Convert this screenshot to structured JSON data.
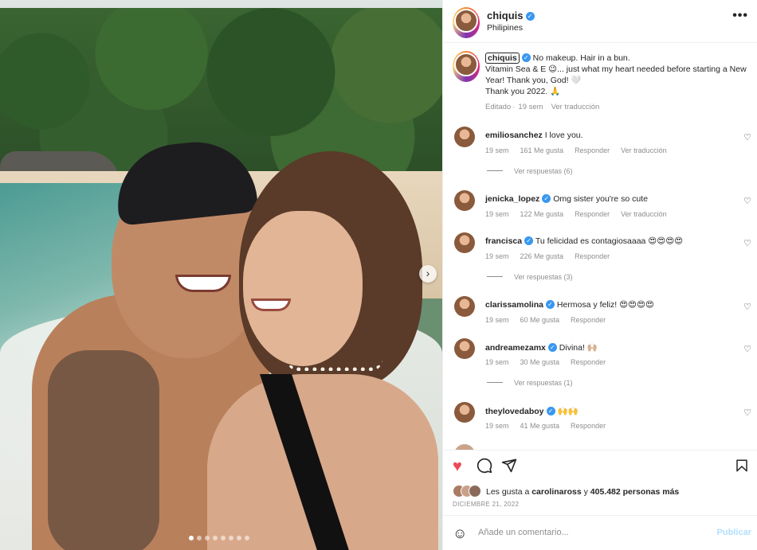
{
  "post": {
    "username": "chiquis",
    "location": "Philipines",
    "more_icon": "more-horizontal-icon",
    "photo_alt_icon": "chevron-right-icon",
    "carousel_dots": 8,
    "carousel_active_index": 0
  },
  "caption": {
    "username": "chiquis",
    "line1": " No makeup. Hair in a bun.",
    "line2": "Vitamin Sea & E 😉... just what my heart needed before starting a New Year! Thank you, God! 🤍",
    "line3": "Thank you 2022. 🙏",
    "edited": "Editado",
    "age": "19 sem",
    "translate": "Ver traducción"
  },
  "comments": [
    {
      "user": "emiliosanchez",
      "verified": false,
      "text": "I love you.",
      "age": "19 sem",
      "likes": "161 Me gusta",
      "reply": "Responder",
      "translate": "Ver traducción",
      "replies": "Ver respuestas (6)"
    },
    {
      "user": "jenicka_lopez",
      "verified": true,
      "text": "Omg sister you're so cute",
      "age": "19 sem",
      "likes": "122 Me gusta",
      "reply": "Responder",
      "translate": "Ver traducción",
      "replies": ""
    },
    {
      "user": "francisca",
      "verified": true,
      "text": "Tu felicidad es contagiosaaaa 😍😍😍😍",
      "age": "19 sem",
      "likes": "226 Me gusta",
      "reply": "Responder",
      "translate": "",
      "replies": "Ver respuestas (3)"
    },
    {
      "user": "clarissamolina",
      "verified": true,
      "text": "Hermosa y feliz! 😍😍😍😍",
      "age": "19 sem",
      "likes": "60 Me gusta",
      "reply": "Responder",
      "translate": "",
      "replies": ""
    },
    {
      "user": "andreamezamx",
      "verified": true,
      "text": "Divina! 🙌🏼",
      "age": "19 sem",
      "likes": "30 Me gusta",
      "reply": "Responder",
      "translate": "",
      "replies": "Ver respuestas (1)"
    },
    {
      "user": "theylovedaboy",
      "verified": true,
      "text": "🙌🙌",
      "age": "19 sem",
      "likes": "41 Me gusta",
      "reply": "Responder",
      "translate": "",
      "replies": ""
    }
  ],
  "actions": {
    "like_icon": "heart-filled-icon",
    "comment_icon": "comment-icon",
    "share_icon": "paper-plane-icon",
    "save_icon": "bookmark-icon",
    "like_color": "#ed4956"
  },
  "likes": {
    "prefix": "Les gusta a ",
    "user": "carolinaross",
    "middle": " y ",
    "count": "405.482 personas más"
  },
  "date": "DICIEMBRE 21, 2022",
  "add_comment": {
    "placeholder": "Añade un comentario...",
    "publish": "Publicar",
    "emoji_icon": "smiley-icon"
  }
}
